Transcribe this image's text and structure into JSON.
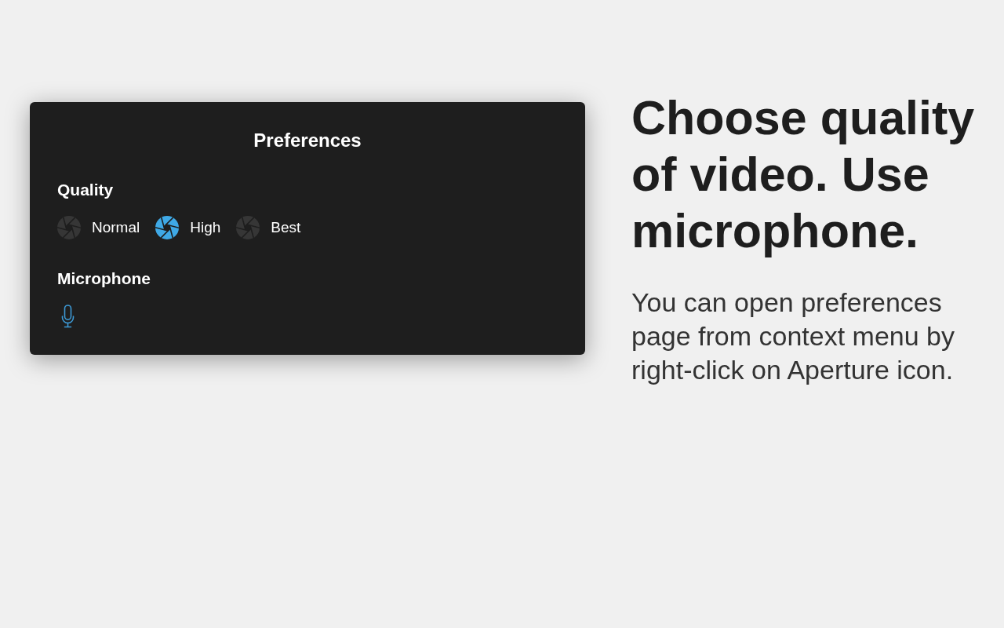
{
  "preferences": {
    "title": "Preferences",
    "quality": {
      "title": "Quality",
      "options": [
        {
          "label": "Normal",
          "selected": false
        },
        {
          "label": "High",
          "selected": true
        },
        {
          "label": "Best",
          "selected": false
        }
      ]
    },
    "microphone": {
      "title": "Microphone",
      "enabled": true
    }
  },
  "headline": "Choose quality of video. Use microphone.",
  "description": "You can open preferences page from context menu by right-click on Aperture icon."
}
